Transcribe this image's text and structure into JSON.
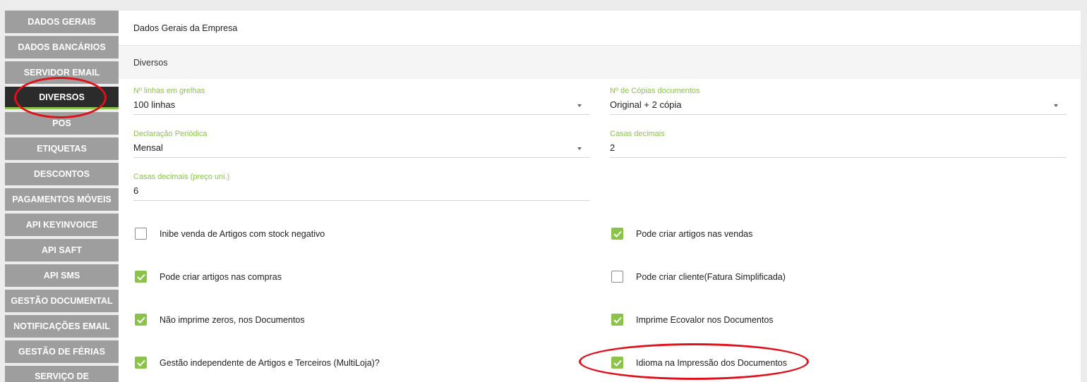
{
  "sidebar": {
    "items": [
      {
        "label": "DADOS GERAIS",
        "active": false
      },
      {
        "label": "DADOS BANCÁRIOS",
        "active": false
      },
      {
        "label": "SERVIDOR EMAIL",
        "active": false
      },
      {
        "label": "DIVERSOS",
        "active": true
      },
      {
        "label": "POS",
        "active": false
      },
      {
        "label": "ETIQUETAS",
        "active": false
      },
      {
        "label": "DESCONTOS",
        "active": false
      },
      {
        "label": "PAGAMENTOS MÓVEIS",
        "active": false
      },
      {
        "label": "API KEYINVOICE",
        "active": false
      },
      {
        "label": "API SAFT",
        "active": false
      },
      {
        "label": "API SMS",
        "active": false
      },
      {
        "label": "GESTÃO DOCUMENTAL",
        "active": false
      },
      {
        "label": "NOTIFICAÇÕES EMAIL",
        "active": false
      },
      {
        "label": "GESTÃO DE FÉRIAS",
        "active": false
      },
      {
        "label": "SERVIÇO DE",
        "active": false
      }
    ]
  },
  "header": {
    "title": "Dados Gerais da Empresa"
  },
  "section": {
    "title": "Diversos"
  },
  "fields": {
    "linhas": {
      "label": "Nº linhas em grelhas",
      "value": "100 linhas"
    },
    "copias": {
      "label": "Nº de Cópias documentos",
      "value": "Original + 2 cópia"
    },
    "declaracao": {
      "label": "Declaração Periódica",
      "value": "Mensal"
    },
    "casas": {
      "label": "Casas decimais",
      "value": "2"
    },
    "casas_preco": {
      "label": "Casas decimais (preço uni.)",
      "value": "6"
    }
  },
  "checkboxes": {
    "inibe": {
      "label": "Inibe venda de Artigos com stock negativo",
      "checked": false
    },
    "criar_vendas": {
      "label": "Pode criar artigos nas vendas",
      "checked": true
    },
    "criar_compras": {
      "label": "Pode criar artigos nas compras",
      "checked": true
    },
    "criar_cliente": {
      "label": "Pode criar cliente(Fatura Simplificada)",
      "checked": false
    },
    "zeros": {
      "label": "Não imprime zeros, nos Documentos",
      "checked": true
    },
    "ecovalor": {
      "label": "Imprime Ecovalor nos Documentos",
      "checked": true
    },
    "multiloja": {
      "label": "Gestão independente de Artigos e Terceiros (MultiLoja)?",
      "checked": true
    },
    "idioma": {
      "label": "Idioma na Impressão dos Documentos",
      "checked": true
    }
  },
  "colors": {
    "accent": "#8bc34a",
    "sidebar": "#9e9e9e",
    "active": "#2b2b2b",
    "annotation": "#e0101a"
  }
}
